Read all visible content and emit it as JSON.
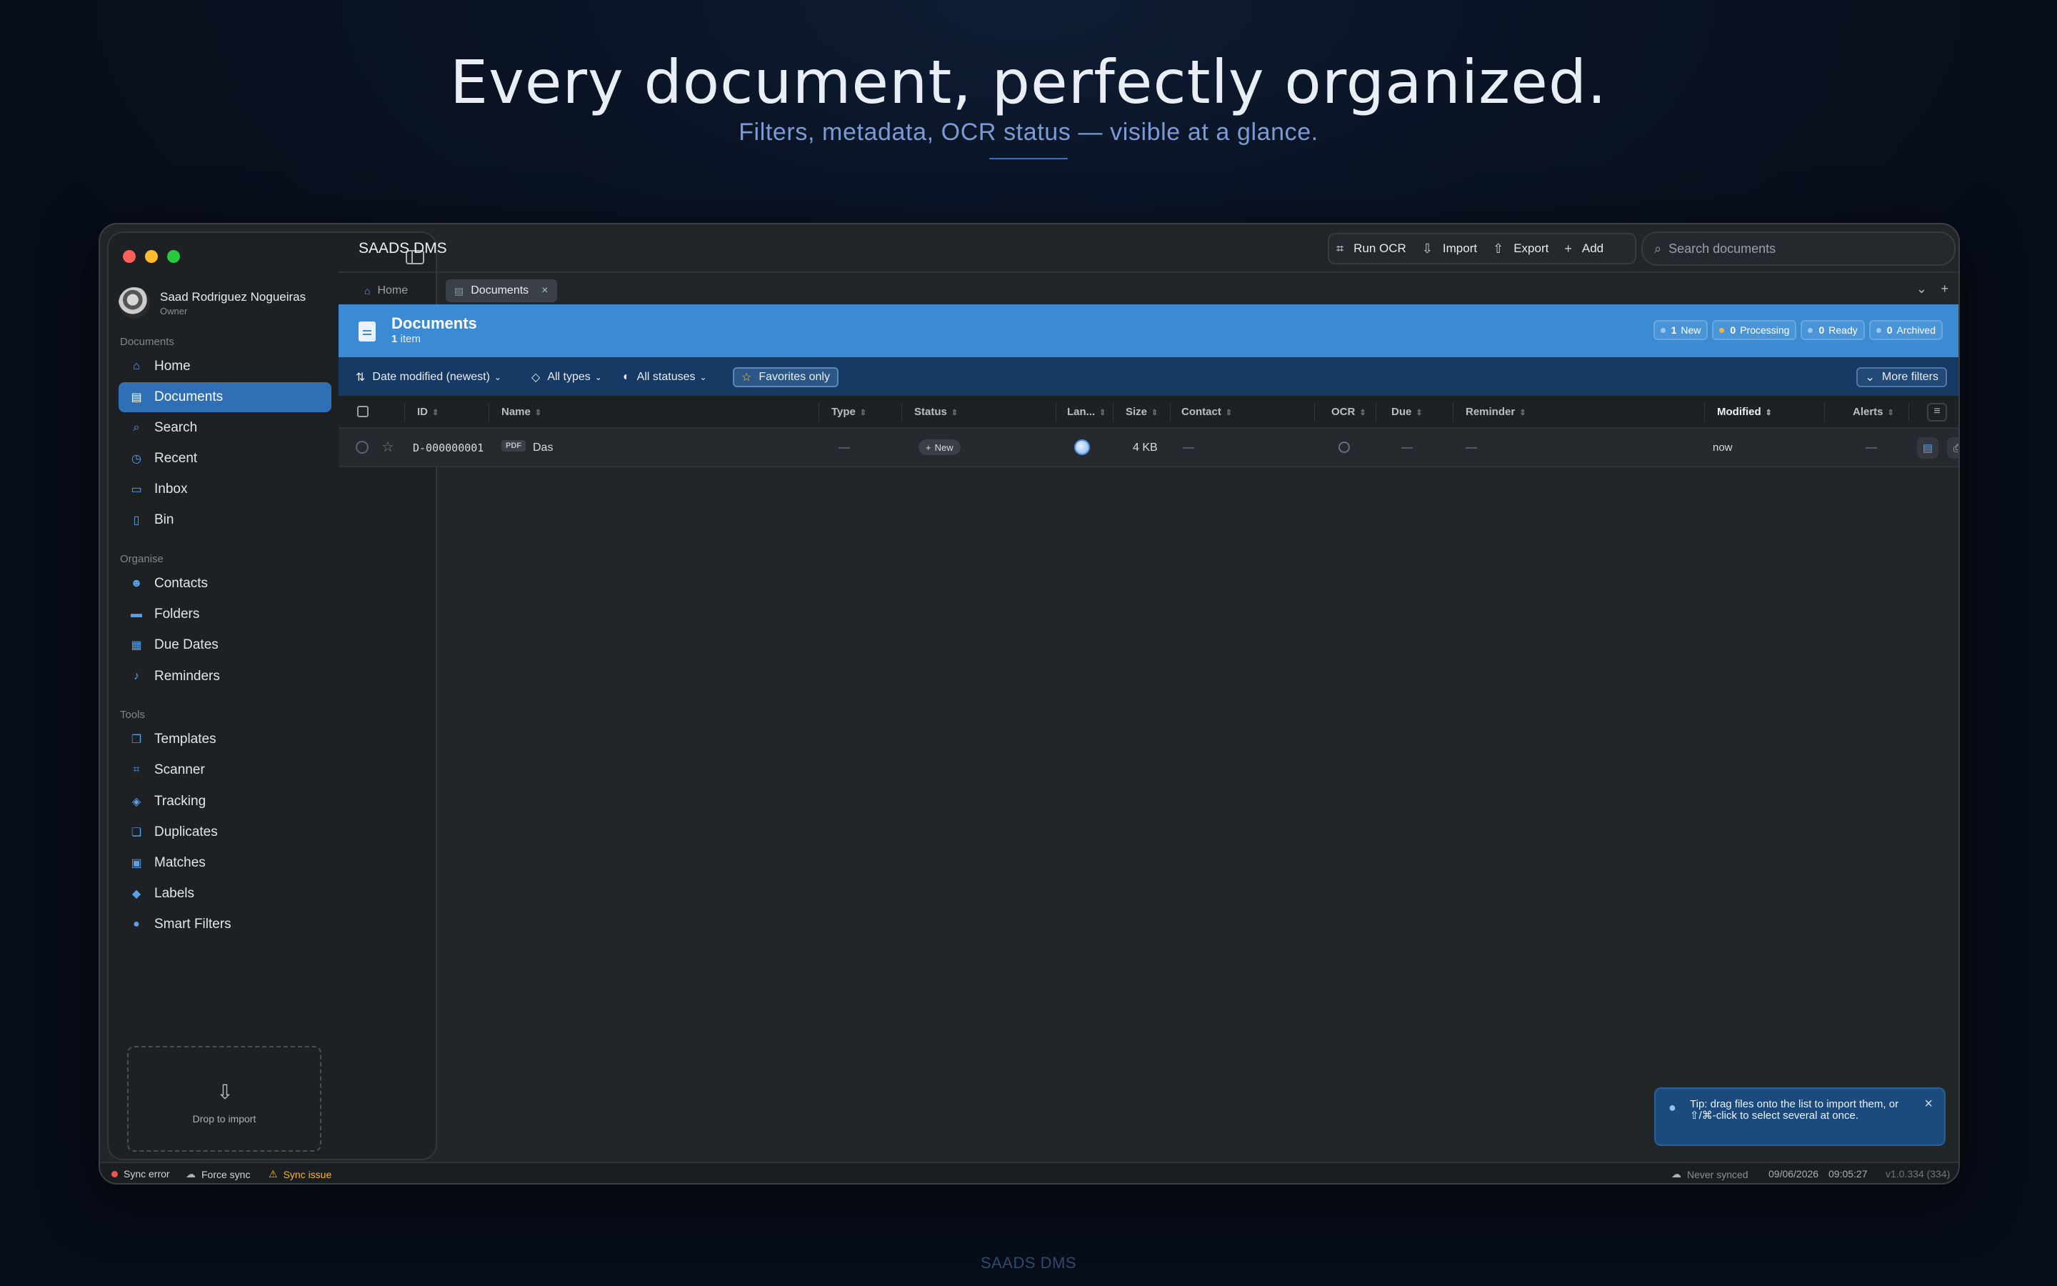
{
  "hero": {
    "title": "Every document, perfectly organized.",
    "subtitle": "Filters, metadata, OCR status — visible at a glance."
  },
  "footer_brand": "SAADS DMS",
  "window": {
    "app_title": "SAADS DMS",
    "user": {
      "name": "Saad Rodriguez Nogueiras",
      "role": "Owner"
    },
    "sidebar": {
      "sections": [
        {
          "label": "Documents",
          "items": [
            {
              "label": "Home",
              "icon": "home-icon"
            },
            {
              "label": "Documents",
              "icon": "document-icon",
              "active": true
            },
            {
              "label": "Search",
              "icon": "search-icon"
            },
            {
              "label": "Recent",
              "icon": "clock-icon"
            },
            {
              "label": "Inbox",
              "icon": "inbox-icon"
            },
            {
              "label": "Bin",
              "icon": "trash-icon"
            }
          ]
        },
        {
          "label": "Organise",
          "items": [
            {
              "label": "Contacts",
              "icon": "contacts-icon"
            },
            {
              "label": "Folders",
              "icon": "folder-icon"
            },
            {
              "label": "Due Dates",
              "icon": "calendar-icon"
            },
            {
              "label": "Reminders",
              "icon": "bell-icon"
            }
          ]
        },
        {
          "label": "Tools",
          "items": [
            {
              "label": "Templates",
              "icon": "templates-icon"
            },
            {
              "label": "Scanner",
              "icon": "scanner-icon"
            },
            {
              "label": "Tracking",
              "icon": "package-icon"
            },
            {
              "label": "Duplicates",
              "icon": "duplicates-icon"
            },
            {
              "label": "Matches",
              "icon": "matches-icon"
            },
            {
              "label": "Labels",
              "icon": "tag-icon"
            },
            {
              "label": "Smart Filters",
              "icon": "filter-icon"
            }
          ]
        }
      ],
      "dropzone_label": "Drop to import"
    },
    "toolbar": {
      "run_ocr": "Run OCR",
      "import": "Import",
      "export": "Export",
      "add": "Add",
      "search_placeholder": "Search documents"
    },
    "tabs": [
      {
        "label": "Home"
      },
      {
        "label": "Documents",
        "active": true
      }
    ],
    "doc_header": {
      "title": "Documents",
      "count_num": "1",
      "count_unit": "item",
      "badges": [
        {
          "count": "1",
          "label": "New",
          "color": "#9cc7ef"
        },
        {
          "count": "0",
          "label": "Processing",
          "color": "#f3b63b"
        },
        {
          "count": "0",
          "label": "Ready",
          "color": "#9cc7ef"
        },
        {
          "count": "0",
          "label": "Archived",
          "color": "#9cc7ef"
        }
      ]
    },
    "filters": {
      "sort": "Date modified (newest)",
      "types": "All types",
      "statuses": "All statuses",
      "favorites": "Favorites only",
      "more": "More filters"
    },
    "columns": [
      "ID",
      "Name",
      "Type",
      "Status",
      "Lan...",
      "Size",
      "Contact",
      "OCR",
      "Due",
      "Reminder",
      "Modified",
      "Alerts"
    ],
    "rows": [
      {
        "id": "D-000000001",
        "file_type": "PDF",
        "name": "Das",
        "type": "—",
        "status": "New",
        "size": "4 KB",
        "contact": "—",
        "due": "—",
        "reminder": "—",
        "modified": "now",
        "alerts": "—"
      }
    ],
    "toast": {
      "text": "Tip: drag files onto the list to import them, or ⇧/⌘-click to select several at once."
    },
    "statusbar": {
      "sync_error": "Sync error",
      "force_sync": "Force sync",
      "sync_issue": "Sync issue",
      "never_synced": "Never synced",
      "date": "09/06/2026",
      "time": "09:05:27",
      "version": "v1.0.334 (334)"
    }
  }
}
